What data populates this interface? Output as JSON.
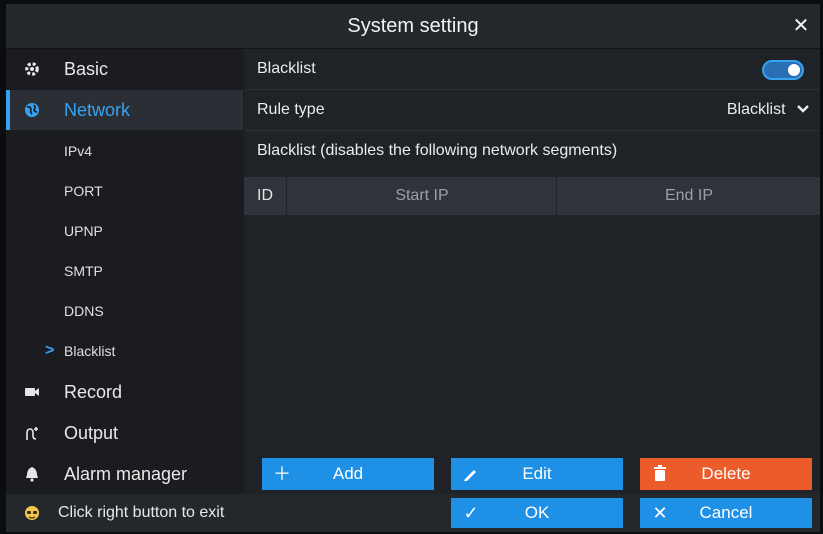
{
  "window": {
    "title": "System setting",
    "close_icon": "close-icon"
  },
  "sidebar": {
    "items": [
      {
        "label": "Basic",
        "icon": "gear-icon"
      },
      {
        "label": "Network",
        "icon": "globe-icon",
        "active": true
      },
      {
        "label": "Record",
        "icon": "camera-icon"
      },
      {
        "label": "Output",
        "icon": "output-icon"
      },
      {
        "label": "Alarm manager",
        "icon": "bell-icon"
      }
    ],
    "subitems": [
      {
        "label": "IPv4"
      },
      {
        "label": "PORT"
      },
      {
        "label": "UPNP"
      },
      {
        "label": "SMTP"
      },
      {
        "label": "DDNS"
      },
      {
        "label": "Blacklist",
        "selected": true
      }
    ]
  },
  "content": {
    "blacklist_label": "Blacklist",
    "blacklist_enabled": true,
    "rule_type_label": "Rule type",
    "rule_type_value": "Blacklist",
    "description": "Blacklist (disables the following network segments)",
    "table": {
      "columns": [
        "ID",
        "Start IP",
        "End IP"
      ],
      "rows": []
    }
  },
  "buttons": {
    "add": "Add",
    "edit": "Edit",
    "delete": "Delete",
    "ok": "OK",
    "cancel": "Cancel"
  },
  "status": {
    "text": "Click right button to exit",
    "icon": "mouse-icon"
  },
  "colors": {
    "accent": "#35a3f2",
    "button_blue": "#1e90e5",
    "button_red": "#ec5b2a"
  }
}
